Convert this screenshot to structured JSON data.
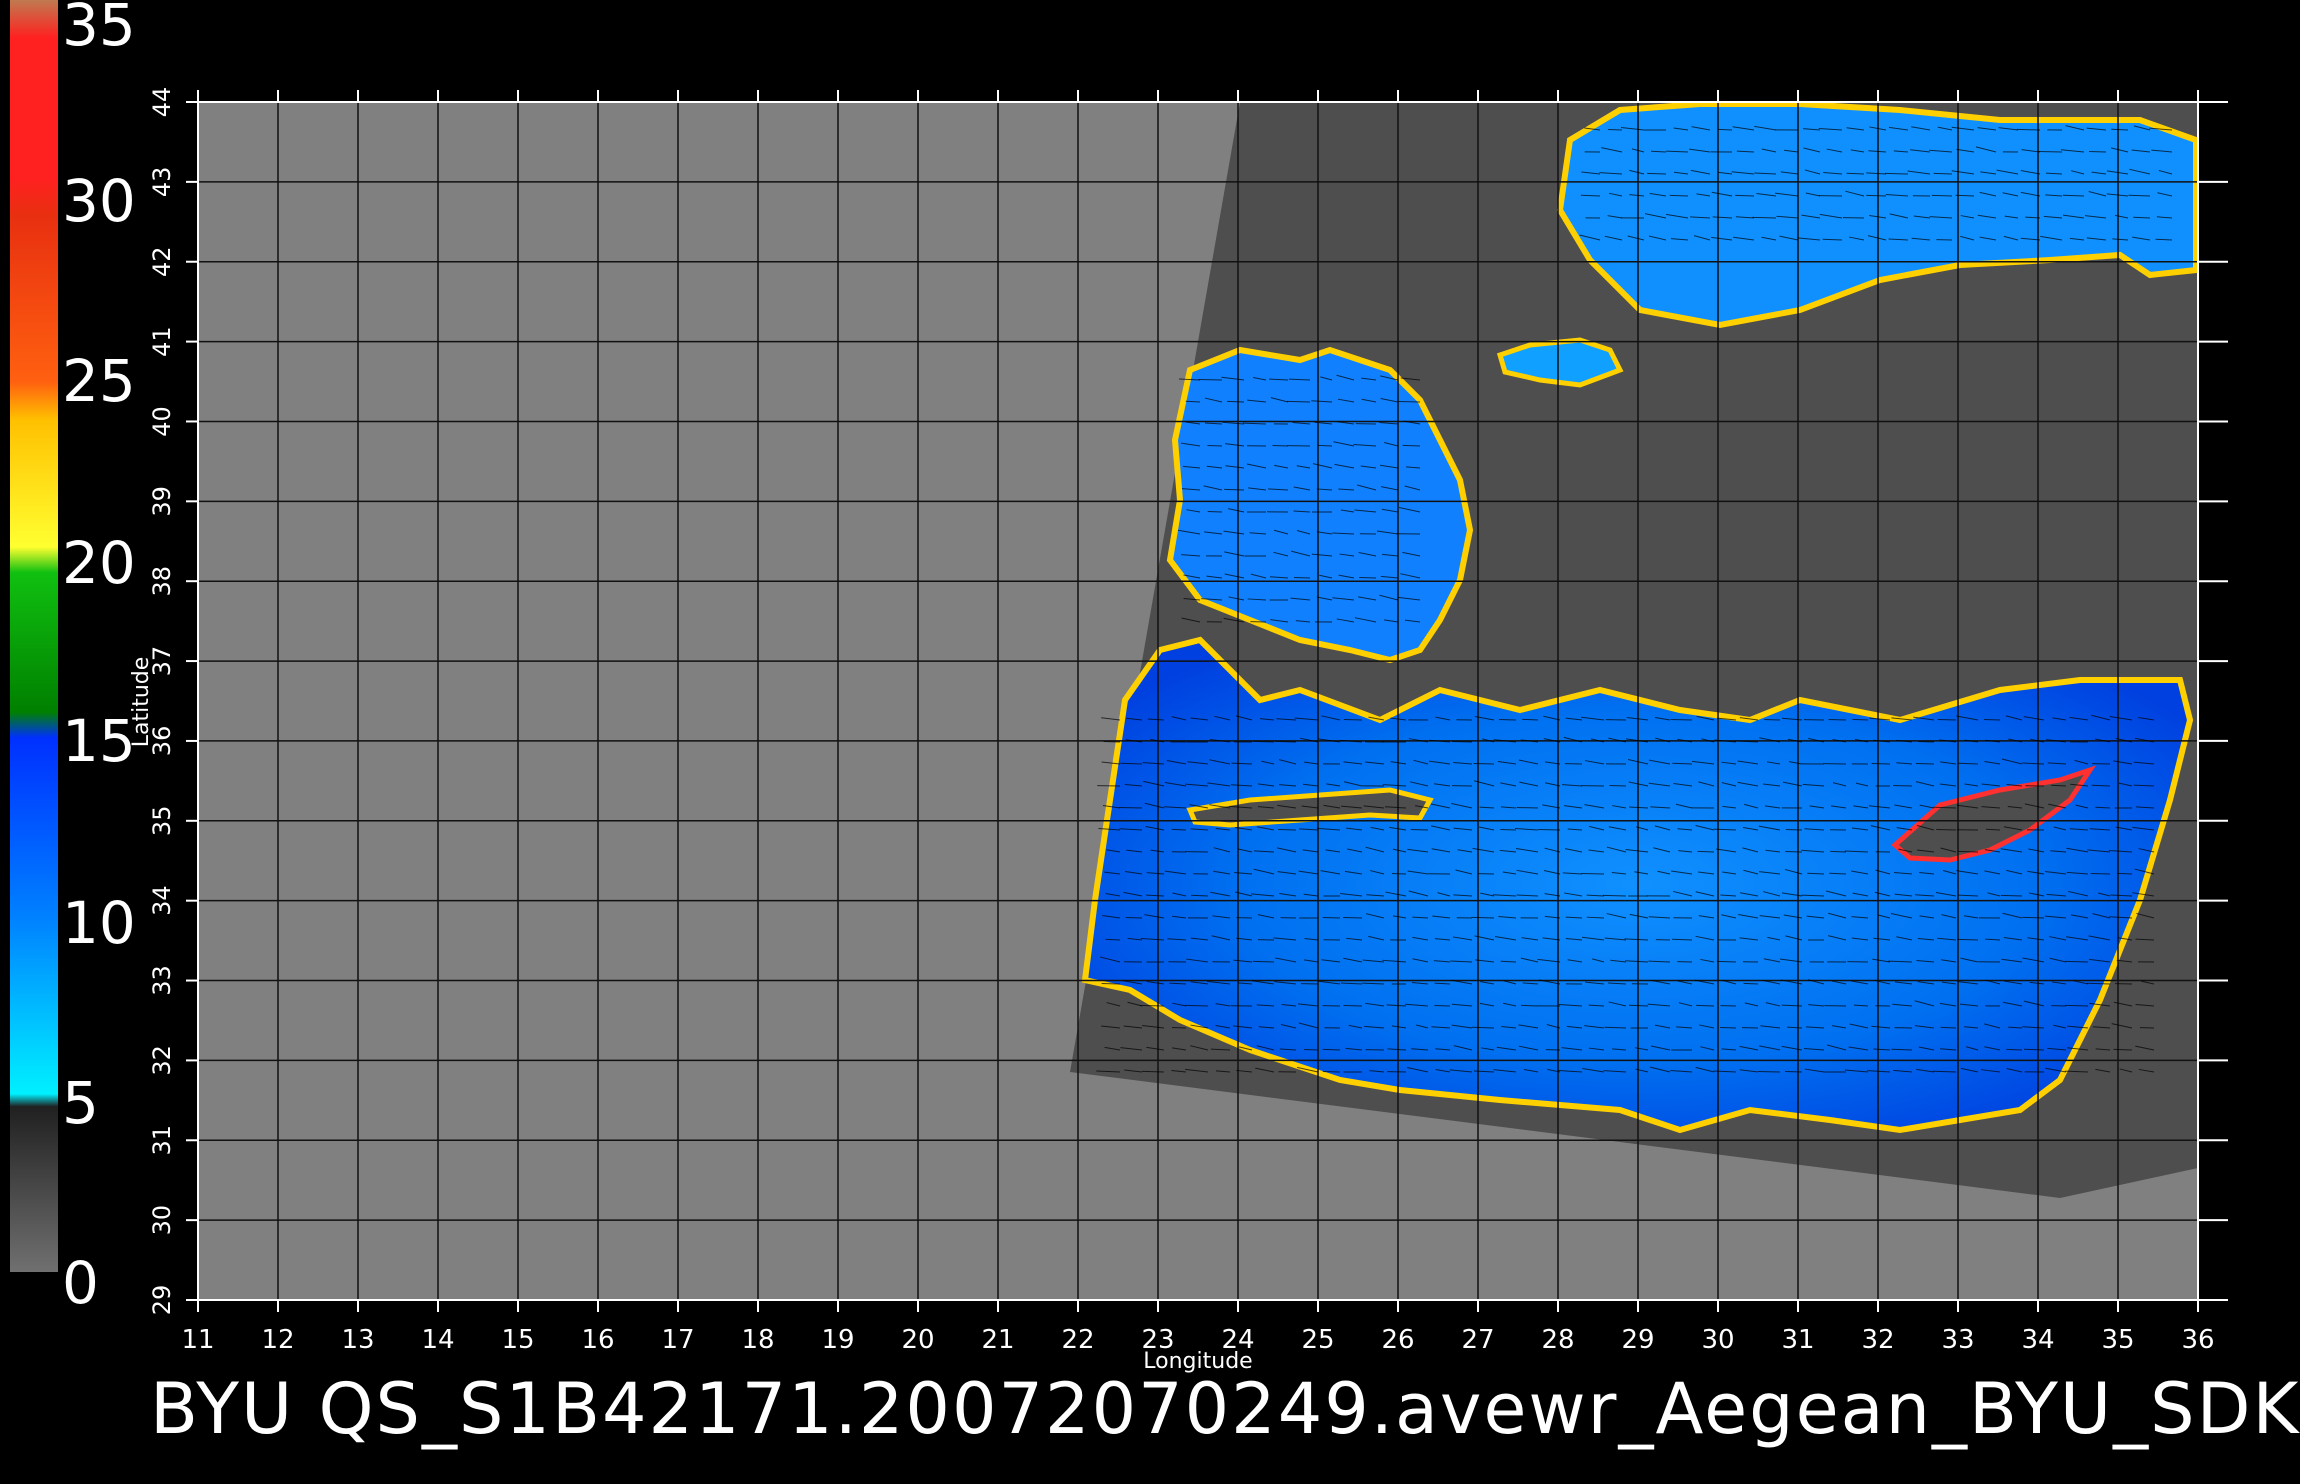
{
  "caption": "BYU QS_S1B42171.20072070249.avewr_Aegean_BYU_SDK",
  "colorbar": {
    "labels": [
      "35",
      "30",
      "25",
      "20",
      "15",
      "10",
      "5",
      "0"
    ],
    "colors": [
      "#c07a50",
      "#ff2020",
      "#ff6010",
      "#ffd000",
      "#10c010",
      "#0050ff",
      "#00e8ff",
      "#606060"
    ]
  },
  "map": {
    "xlabel": "Longitude",
    "ylabel": "Latitude",
    "lon_ticks": [
      "11",
      "12",
      "13",
      "14",
      "15",
      "16",
      "17",
      "18",
      "19",
      "20",
      "21",
      "22",
      "23",
      "24",
      "25",
      "26",
      "27",
      "28",
      "29",
      "30",
      "31",
      "32",
      "33",
      "34",
      "35",
      "36"
    ],
    "lat_ticks": [
      "29",
      "30",
      "31",
      "32",
      "33",
      "34",
      "35",
      "36",
      "37",
      "38",
      "39",
      "40",
      "41",
      "42",
      "43",
      "44"
    ],
    "lon_range": [
      11,
      36
    ],
    "lat_range": [
      29,
      44
    ],
    "background_color": "#808080",
    "swath_color": "#505050",
    "grid": true
  }
}
